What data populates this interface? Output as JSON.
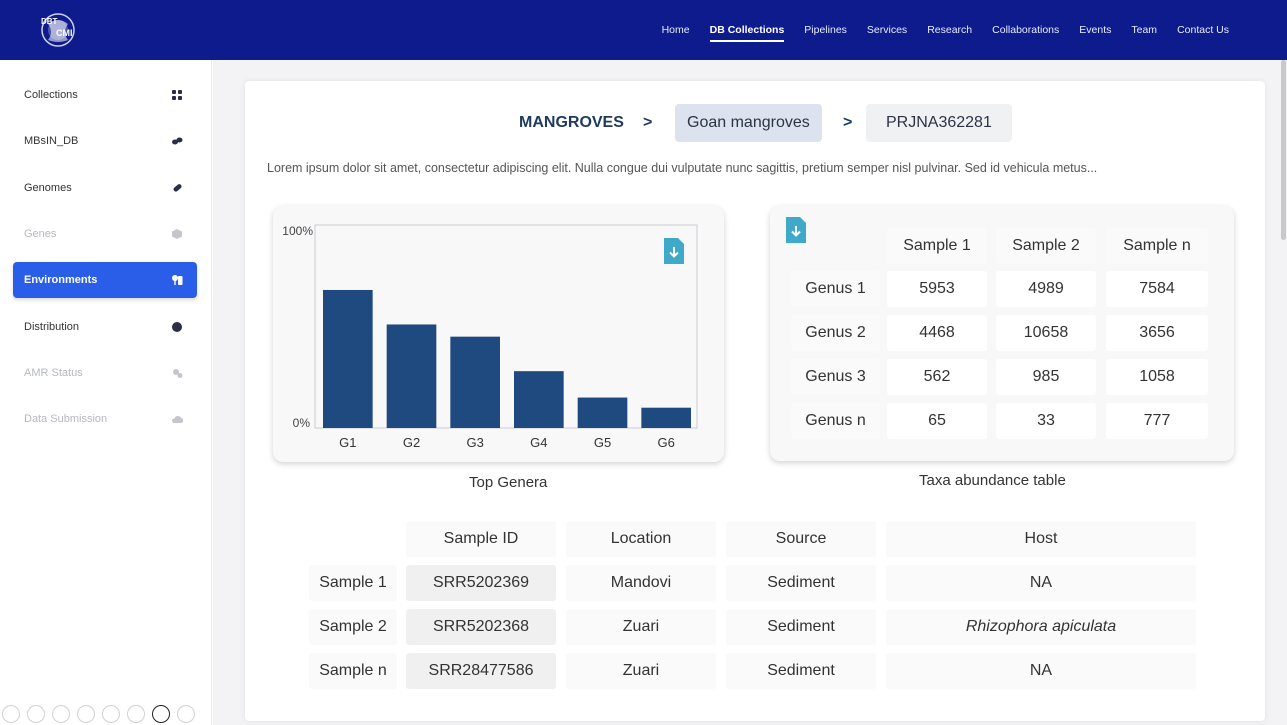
{
  "nav": {
    "logo_text": "DBT-CMI",
    "items": [
      "Home",
      "DB Collections",
      "Pipelines",
      "Services",
      "Research",
      "Collaborations",
      "Events",
      "Team",
      "Contact Us"
    ],
    "active": "DB Collections"
  },
  "sidebar": {
    "items": [
      {
        "label": "Collections",
        "icon": "grid-icon",
        "state": "normal"
      },
      {
        "label": "MBsIN_DB",
        "icon": "pill-icon",
        "state": "normal"
      },
      {
        "label": "Genomes",
        "icon": "capsule-icon",
        "state": "normal"
      },
      {
        "label": "Genes",
        "icon": "cube-icon",
        "state": "disabled"
      },
      {
        "label": "Environments",
        "icon": "tree-icon",
        "state": "active"
      },
      {
        "label": "Distribution",
        "icon": "globe-icon",
        "state": "normal"
      },
      {
        "label": "AMR Status",
        "icon": "virus-icon",
        "state": "disabled"
      },
      {
        "label": "Data Submission",
        "icon": "cloud-icon",
        "state": "disabled"
      }
    ]
  },
  "breadcrumb": {
    "level1": "MANGROVES",
    "sep": ">",
    "level2": "Goan mangroves",
    "level3": "PRJNA362281"
  },
  "description": "Lorem ipsum dolor sit amet, consectetur adipiscing elit. Nulla congue dui vulputate nunc sagittis, pretium semper nisl pulvinar. Sed id vehicula metus...",
  "chart_data": {
    "type": "bar",
    "title": "Top Genera",
    "categories": [
      "G1",
      "G2",
      "G3",
      "G4",
      "G5",
      "G6"
    ],
    "values": [
      68,
      51,
      45,
      28,
      15,
      10
    ],
    "ylim": [
      0,
      100
    ],
    "ytick_labels": [
      "0%",
      "100%"
    ],
    "bar_color": "#1f4a7f"
  },
  "abundance": {
    "caption": "Taxa abundance table",
    "columns": [
      "Sample 1",
      "Sample 2",
      "Sample n"
    ],
    "rows": [
      {
        "label": "Genus 1",
        "values": [
          "5953",
          "4989",
          "7584"
        ]
      },
      {
        "label": "Genus 2",
        "values": [
          "4468",
          "10658",
          "3656"
        ]
      },
      {
        "label": "Genus 3",
        "values": [
          "562",
          "985",
          "1058"
        ]
      },
      {
        "label": "Genus n",
        "values": [
          "65",
          "33",
          "777"
        ]
      }
    ]
  },
  "samples": {
    "columns": [
      "Sample ID",
      "Location",
      "Source",
      "Host"
    ],
    "rows": [
      {
        "label": "Sample 1",
        "values": [
          "SRR5202369",
          "Mandovi",
          "Sediment",
          "NA"
        ]
      },
      {
        "label": "Sample 2",
        "values": [
          "SRR5202368",
          "Zuari",
          "Sediment",
          "Rhizophora apiculata"
        ]
      },
      {
        "label": "Sample n",
        "values": [
          "SRR28477586",
          "Zuari",
          "Sediment",
          "NA"
        ]
      }
    ]
  },
  "colors": {
    "nav_bg": "#0d1b8c",
    "accent": "#2b5ee8",
    "download_icon": "#3fa9c9"
  }
}
